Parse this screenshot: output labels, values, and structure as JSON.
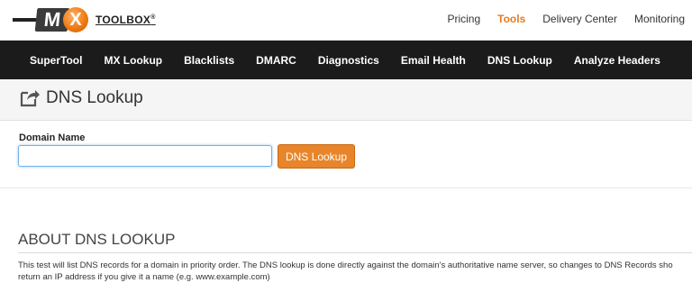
{
  "logo": {
    "m": "M",
    "x": "X",
    "word": "TOOLBOX",
    "reg": "®"
  },
  "topnav": {
    "items": [
      {
        "label": "Pricing"
      },
      {
        "label": "Tools",
        "active": true
      },
      {
        "label": "Delivery Center"
      },
      {
        "label": "Monitoring"
      }
    ]
  },
  "mainnav": {
    "items": [
      {
        "label": "SuperTool"
      },
      {
        "label": "MX Lookup"
      },
      {
        "label": "Blacklists"
      },
      {
        "label": "DMARC"
      },
      {
        "label": "Diagnostics"
      },
      {
        "label": "Email Health"
      },
      {
        "label": "DNS Lookup"
      },
      {
        "label": "Analyze Headers"
      }
    ]
  },
  "page": {
    "title": "DNS Lookup"
  },
  "form": {
    "domain_label": "Domain Name",
    "domain_value": "",
    "submit_label": "DNS Lookup"
  },
  "about": {
    "heading": "ABOUT DNS LOOKUP",
    "line1": "This test will list DNS records for a domain in priority order. The DNS lookup is done directly against the domain's authoritative name server, so changes to DNS Records sho",
    "line2": "return an IP address if you give it a name (e.g. www.example.com)"
  },
  "colors": {
    "accent": "#e57b1f",
    "nav_bg": "#1b1b1b",
    "button": "#e8852a"
  }
}
